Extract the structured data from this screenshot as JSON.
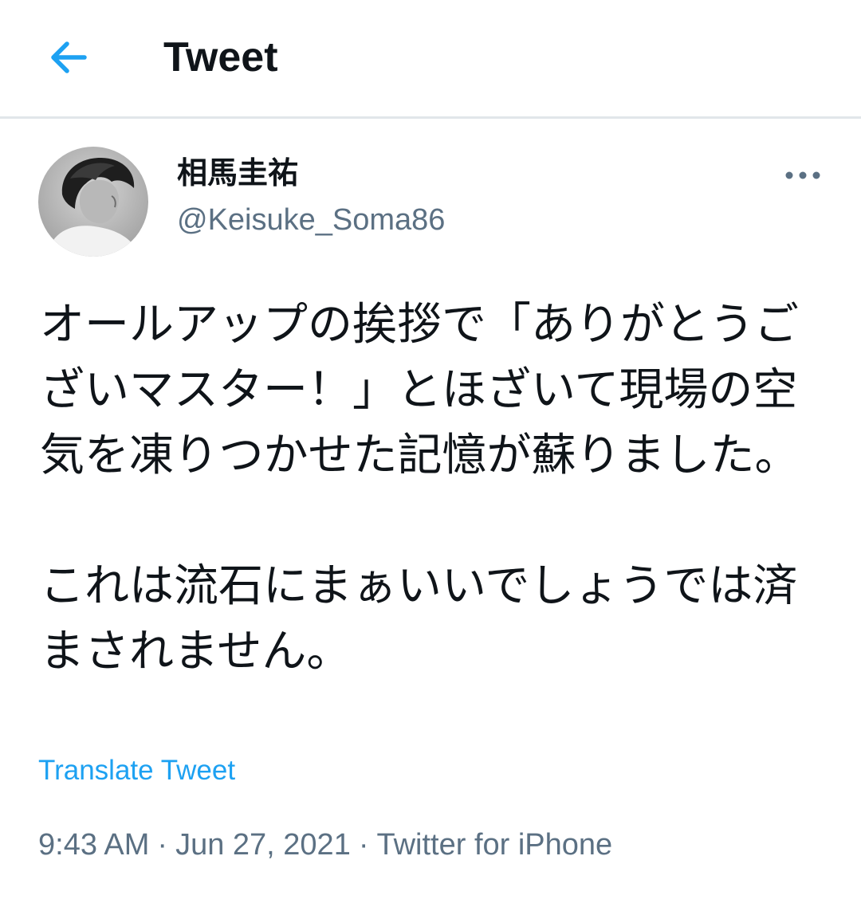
{
  "header": {
    "title": "Tweet",
    "back_icon": "arrow-left-icon",
    "accent_color": "#1da1f2"
  },
  "author": {
    "display_name": "相馬圭祐",
    "handle": "@Keisuke_Soma86",
    "avatar_icon": "profile-photo"
  },
  "more_icon": "more-horizontal-icon",
  "tweet": {
    "text": "オールアップの挨拶で「ありがとうございマスター！」とほざいて現場の空気を凍りつかせた記憶が蘇りました。\n\nこれは流石にまぁいいでしょうでは済まされません。",
    "translate_label": "Translate Tweet",
    "time": "9:43 AM",
    "date": "Jun 27, 2021",
    "source": "Twitter for iPhone",
    "separator": "·"
  }
}
